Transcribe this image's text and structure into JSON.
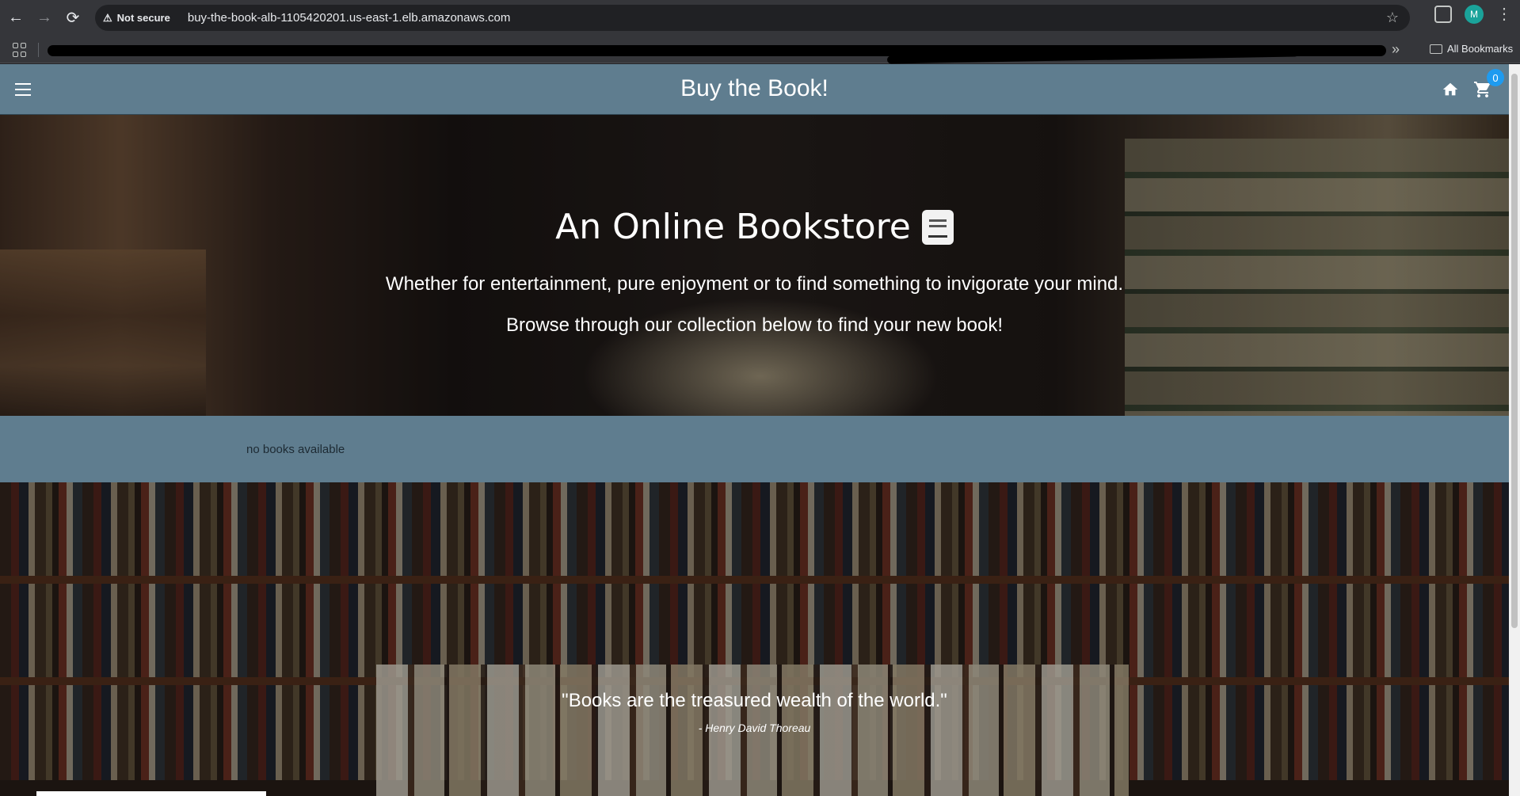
{
  "browser": {
    "security_label": "Not secure",
    "url": "buy-the-book-alb-1105420201.us-east-1.elb.amazonaws.com",
    "profile_initial": "M",
    "all_bookmarks_label": "All Bookmarks"
  },
  "header": {
    "title": "Buy the Book!",
    "cart_count": "0"
  },
  "hero": {
    "title": "An Online Bookstore",
    "line1": "Whether for entertainment, pure enjoyment or to find something to invigorate your mind.",
    "line2": "Browse through our collection below to find your new book!"
  },
  "books": {
    "empty_message": "no books available"
  },
  "quote": {
    "text": "\"Books are the treasured wealth of the world.\"",
    "author": "- Henry David Thoreau"
  },
  "icons": {
    "menu": "hamburger-icon",
    "home": "home-icon",
    "cart": "cart-icon",
    "book": "book-icon"
  }
}
